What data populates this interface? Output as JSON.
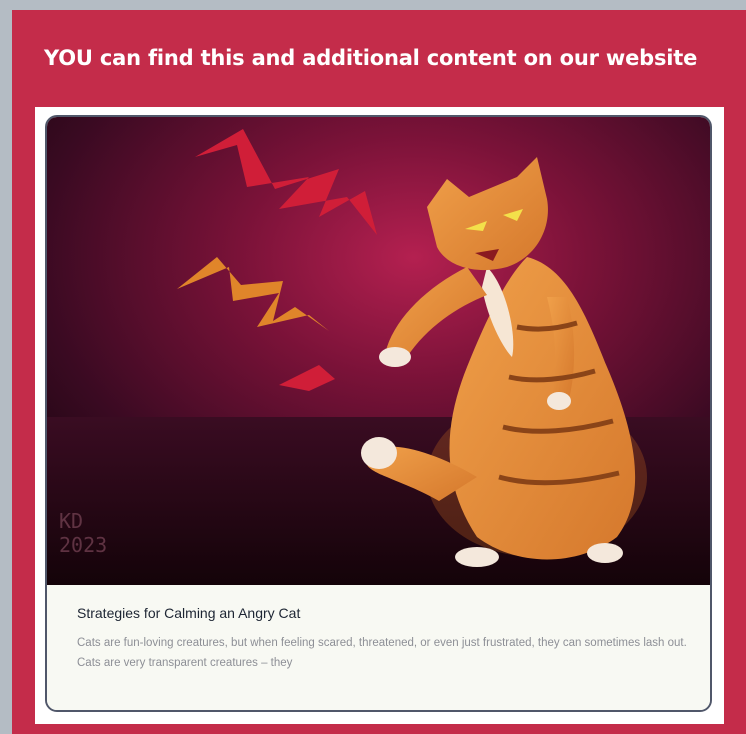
{
  "banner": {
    "text": "YOU can find this and additional content on our website"
  },
  "card": {
    "signature": "KD\n2023",
    "title": "Strategies for Calming an Angry Cat",
    "description": "Cats are fun-loving creatures, but when feeling scared, threatened, or even just frustrated, they can sometimes lash out. Cats are very transparent creatures – they"
  },
  "colors": {
    "frame": "#c42c4a",
    "outer_background": "#b4bcc4",
    "card_border": "#50576a",
    "caption_background": "#f8f9f3"
  }
}
